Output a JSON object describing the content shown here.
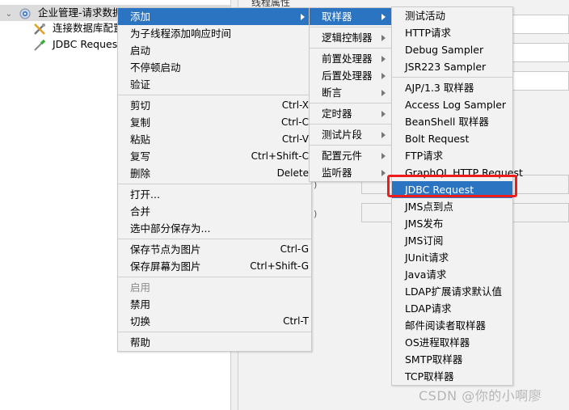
{
  "tree": {
    "items": [
      {
        "label": "企业管理-请求数据库",
        "icon": "thread-group-gear-icon",
        "expanded": true,
        "selected": true
      },
      {
        "label": "连接数据库配置",
        "icon": "config-wrench-icon"
      },
      {
        "label": "JDBC Request请求",
        "icon": "sampler-pipette-icon"
      }
    ]
  },
  "right_panel": {
    "section_title": "线程属性",
    "paren_marks": [
      ")",
      ")"
    ]
  },
  "context_menu": {
    "groups": [
      [
        {
          "label": "添加",
          "submenu": true,
          "highlighted": true
        },
        {
          "label": "为子线程添加响应时间"
        },
        {
          "label": "启动"
        },
        {
          "label": "不停顿启动"
        },
        {
          "label": "验证"
        }
      ],
      [
        {
          "label": "剪切",
          "shortcut": "Ctrl-X"
        },
        {
          "label": "复制",
          "shortcut": "Ctrl-C"
        },
        {
          "label": "粘贴",
          "shortcut": "Ctrl-V"
        },
        {
          "label": "复写",
          "shortcut": "Ctrl+Shift-C"
        },
        {
          "label": "删除",
          "shortcut": "Delete"
        }
      ],
      [
        {
          "label": "打开..."
        },
        {
          "label": "合并"
        },
        {
          "label": "选中部分保存为..."
        }
      ],
      [
        {
          "label": "保存节点为图片",
          "shortcut": "Ctrl-G"
        },
        {
          "label": "保存屏幕为图片",
          "shortcut": "Ctrl+Shift-G"
        }
      ],
      [
        {
          "label": "启用",
          "disabled": true
        },
        {
          "label": "禁用"
        },
        {
          "label": "切换",
          "shortcut": "Ctrl-T"
        }
      ],
      [
        {
          "label": "帮助"
        }
      ]
    ]
  },
  "add_submenu": {
    "groups": [
      [
        {
          "label": "取样器",
          "submenu": true,
          "highlighted": true
        }
      ],
      [
        {
          "label": "逻辑控制器",
          "submenu": true
        }
      ],
      [
        {
          "label": "前置处理器",
          "submenu": true
        },
        {
          "label": "后置处理器",
          "submenu": true
        },
        {
          "label": "断言",
          "submenu": true
        }
      ],
      [
        {
          "label": "定时器",
          "submenu": true
        }
      ],
      [
        {
          "label": "测试片段",
          "submenu": true
        }
      ],
      [
        {
          "label": "配置元件",
          "submenu": true
        },
        {
          "label": "监听器",
          "submenu": true
        }
      ]
    ]
  },
  "sampler_submenu": {
    "groups": [
      [
        {
          "label": "测试活动"
        },
        {
          "label": "HTTP请求"
        },
        {
          "label": "Debug Sampler"
        },
        {
          "label": "JSR223 Sampler"
        }
      ],
      [
        {
          "label": "AJP/1.3 取样器"
        },
        {
          "label": "Access Log Sampler"
        },
        {
          "label": "BeanShell 取样器"
        },
        {
          "label": "Bolt Request"
        },
        {
          "label": "FTP请求"
        },
        {
          "label": "GraphQL HTTP Request"
        },
        {
          "label": "JDBC Request",
          "highlighted": true,
          "annotated": true
        },
        {
          "label": "JMS点到点"
        },
        {
          "label": "JMS发布"
        },
        {
          "label": "JMS订阅"
        },
        {
          "label": "JUnit请求"
        },
        {
          "label": "Java请求"
        },
        {
          "label": "LDAP扩展请求默认值"
        },
        {
          "label": "LDAP请求"
        },
        {
          "label": "邮件阅读者取样器"
        },
        {
          "label": "OS进程取样器"
        },
        {
          "label": "SMTP取样器"
        },
        {
          "label": "TCP取样器"
        }
      ]
    ]
  },
  "colors": {
    "highlight": "#2b74c2",
    "annotation_box": "#ef1c1c",
    "menu_bg": "#f2f2f2"
  },
  "watermark": "CSDN @你的小啊廖"
}
